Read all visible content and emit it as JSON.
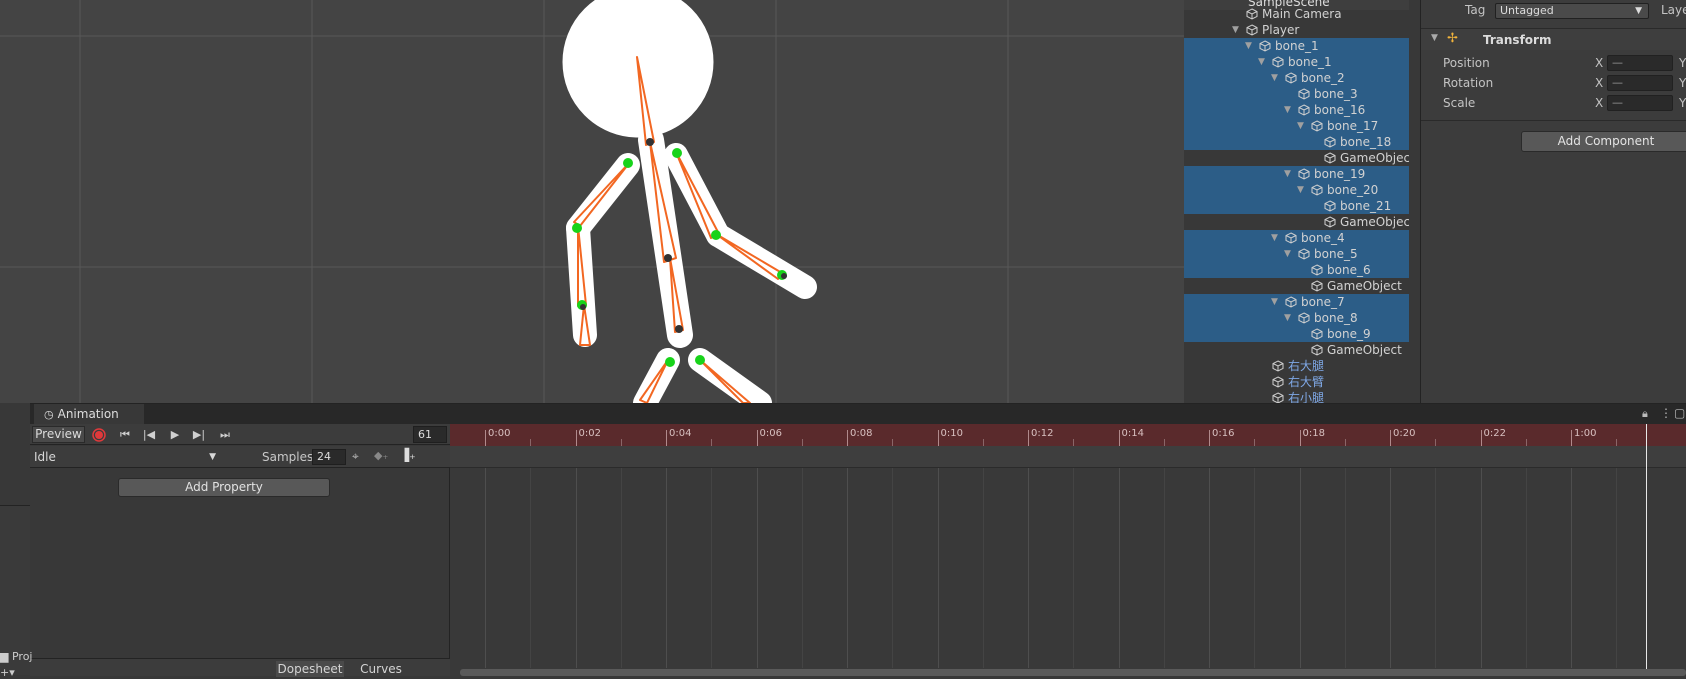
{
  "hierarchy": {
    "scene_name": "SampleScene",
    "items": [
      {
        "label": "Main Camera",
        "depth": 1,
        "arrow": "",
        "selected": false,
        "cn": false,
        "prefab": false
      },
      {
        "label": "Player",
        "depth": 1,
        "arrow": "▼",
        "selected": false,
        "cn": false,
        "prefab": false
      },
      {
        "label": "bone_1",
        "depth": 2,
        "arrow": "▼",
        "selected": true,
        "cn": false,
        "prefab": false
      },
      {
        "label": "bone_1",
        "depth": 3,
        "arrow": "▼",
        "selected": true,
        "cn": false,
        "prefab": false
      },
      {
        "label": "bone_2",
        "depth": 4,
        "arrow": "▼",
        "selected": true,
        "cn": false,
        "prefab": false
      },
      {
        "label": "bone_3",
        "depth": 5,
        "arrow": "",
        "selected": true,
        "cn": false,
        "prefab": false
      },
      {
        "label": "bone_16",
        "depth": 5,
        "arrow": "▼",
        "selected": true,
        "cn": false,
        "prefab": false
      },
      {
        "label": "bone_17",
        "depth": 6,
        "arrow": "▼",
        "selected": true,
        "cn": false,
        "prefab": false
      },
      {
        "label": "bone_18",
        "depth": 7,
        "arrow": "",
        "selected": true,
        "cn": false,
        "prefab": false
      },
      {
        "label": "GameObject",
        "depth": 7,
        "arrow": "",
        "selected": false,
        "cn": false,
        "prefab": true
      },
      {
        "label": "bone_19",
        "depth": 5,
        "arrow": "▼",
        "selected": true,
        "cn": false,
        "prefab": false
      },
      {
        "label": "bone_20",
        "depth": 6,
        "arrow": "▼",
        "selected": true,
        "cn": false,
        "prefab": false
      },
      {
        "label": "bone_21",
        "depth": 7,
        "arrow": "",
        "selected": true,
        "cn": false,
        "prefab": false
      },
      {
        "label": "GameObject",
        "depth": 7,
        "arrow": "",
        "selected": false,
        "cn": false,
        "prefab": true
      },
      {
        "label": "bone_4",
        "depth": 4,
        "arrow": "▼",
        "selected": true,
        "cn": false,
        "prefab": false
      },
      {
        "label": "bone_5",
        "depth": 5,
        "arrow": "▼",
        "selected": true,
        "cn": false,
        "prefab": false
      },
      {
        "label": "bone_6",
        "depth": 6,
        "arrow": "",
        "selected": true,
        "cn": false,
        "prefab": false
      },
      {
        "label": "GameObject",
        "depth": 6,
        "arrow": "",
        "selected": false,
        "cn": false,
        "prefab": true
      },
      {
        "label": "bone_7",
        "depth": 4,
        "arrow": "▼",
        "selected": true,
        "cn": false,
        "prefab": false
      },
      {
        "label": "bone_8",
        "depth": 5,
        "arrow": "▼",
        "selected": true,
        "cn": false,
        "prefab": false
      },
      {
        "label": "bone_9",
        "depth": 6,
        "arrow": "",
        "selected": true,
        "cn": false,
        "prefab": false
      },
      {
        "label": "GameObject",
        "depth": 6,
        "arrow": "",
        "selected": false,
        "cn": false,
        "prefab": true
      },
      {
        "label": "右大腿",
        "depth": 3,
        "arrow": "",
        "selected": false,
        "cn": true,
        "prefab": false
      },
      {
        "label": "右大臂",
        "depth": 3,
        "arrow": "",
        "selected": false,
        "cn": true,
        "prefab": false
      },
      {
        "label": "右小腿",
        "depth": 3,
        "arrow": "",
        "selected": false,
        "cn": true,
        "prefab": false
      }
    ]
  },
  "inspector": {
    "tag_label": "Tag",
    "tag_value": "Untagged",
    "layer_label": "Laye",
    "transform_title": "Transform",
    "rows": [
      {
        "label": "Position",
        "x": "—"
      },
      {
        "label": "Rotation",
        "x": "—"
      },
      {
        "label": "Scale",
        "x": "—"
      }
    ],
    "axis_x": "X",
    "axis_y": "Y",
    "add_component": "Add Component"
  },
  "animation": {
    "tab_label": "Animation",
    "preview_label": "Preview",
    "frame": "61",
    "clip": "Idle",
    "samples_label": "Samples",
    "samples_value": "24",
    "add_property": "Add Property",
    "dopesheet_label": "Dopesheet",
    "curves_label": "Curves",
    "ruler_ticks": [
      "0:00",
      "0:02",
      "0:04",
      "0:06",
      "0:08",
      "0:10",
      "0:12",
      "0:14",
      "0:16",
      "0:18",
      "0:20",
      "0:22",
      "1:00"
    ]
  },
  "project": {
    "tab_label": "Proj"
  },
  "colors": {
    "selection": "#2c5d87",
    "bone": "#f26722",
    "joint": "#18d31a",
    "ruler": "#5a2a2c",
    "record": "#e0393b"
  }
}
